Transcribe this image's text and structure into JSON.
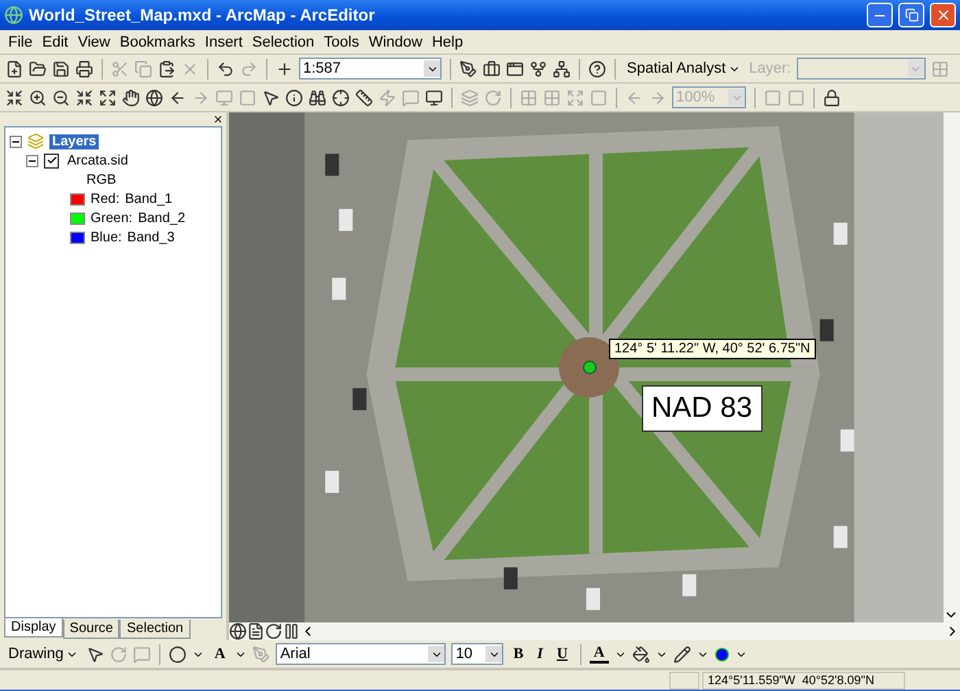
{
  "window": {
    "title": "World_Street_Map.mxd - ArcMap - ArcEditor"
  },
  "menu": [
    "File",
    "Edit",
    "View",
    "Bookmarks",
    "Insert",
    "Selection",
    "Tools",
    "Window",
    "Help"
  ],
  "standard_toolbar": {
    "scale": "1:587",
    "spatial_analyst": "Spatial Analyst",
    "layer_label": "Layer:",
    "layer_disabled": true
  },
  "tools_toolbar": {
    "zoom": "100%",
    "zoom_disabled": true
  },
  "toc": {
    "label": "Layers",
    "selected": true,
    "expanded": true,
    "children": [
      {
        "label": "Arcata.sid",
        "checked": true,
        "expanded": true,
        "legend_title": "RGB",
        "bands": [
          {
            "channel": "Red:",
            "band": "Band_1",
            "color": "#ff0000"
          },
          {
            "channel": "Green:",
            "band": "Band_2",
            "color": "#00ff00"
          },
          {
            "channel": "Blue:",
            "band": "Band_3",
            "color": "#0000ff"
          }
        ]
      }
    ]
  },
  "toc_tabs": [
    {
      "label": "Display",
      "selected": true
    },
    {
      "label": "Source",
      "selected": false
    },
    {
      "label": "Selection",
      "selected": false
    }
  ],
  "map": {
    "tooltip": "124° 5' 11.22\" W, 40° 52' 6.75\"N",
    "label": "NAD 83"
  },
  "drawing_toolbar": {
    "menu": "Drawing",
    "text_tool": "A",
    "font": "Arial",
    "size": "10",
    "bold": "B",
    "italic": "I",
    "underline": "U",
    "font_color": "A"
  },
  "status_bar": {
    "coordinates": "124°5'11.559\"W  40°52'8.09\"N"
  }
}
